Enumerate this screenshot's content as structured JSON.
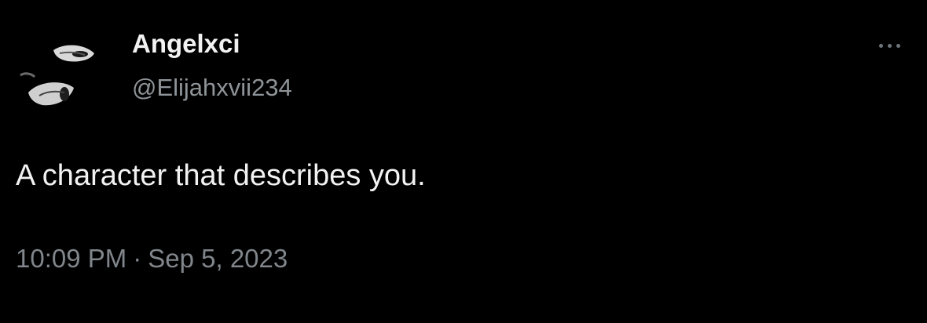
{
  "tweet": {
    "author": {
      "display_name": "Angelxci",
      "handle": "@Elijahxvii234",
      "avatar_icon": "profile-photo"
    },
    "more_icon": "more-horizontal-icon",
    "text": "A character that describes you.",
    "time": "10:09 PM",
    "separator": "·",
    "date": "Sep 5, 2023"
  },
  "colors": {
    "background": "#000000",
    "primary_text": "#f2f2f2",
    "secondary_text": "#80868b"
  }
}
